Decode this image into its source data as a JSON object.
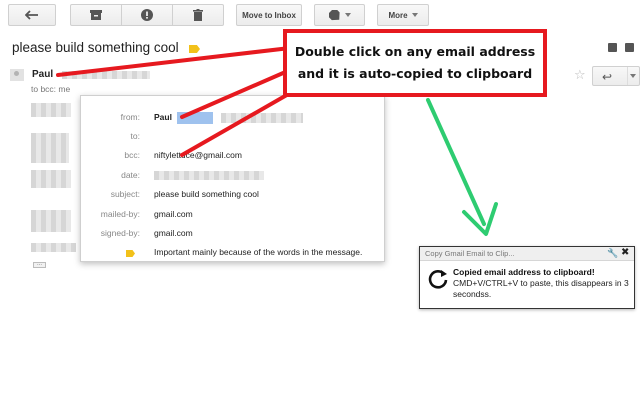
{
  "toolbar": {
    "move_to_inbox_label": "Move to Inbox",
    "more_label": "More",
    "icons": [
      "back-arrow-icon",
      "archive-icon",
      "report-spam-icon",
      "trash-icon",
      "label-icon"
    ]
  },
  "email": {
    "subject": "please build something cool",
    "sender_name": "Paul",
    "to_line": "to bcc: me"
  },
  "details": {
    "rows": [
      {
        "key": "from:",
        "value": "Paul"
      },
      {
        "key": "to:",
        "value": ""
      },
      {
        "key": "bcc:",
        "value": "niftylettuce@gmail.com"
      },
      {
        "key": "date:",
        "value": ""
      },
      {
        "key": "subject:",
        "value": "please build something cool"
      },
      {
        "key": "mailed-by:",
        "value": "gmail.com"
      },
      {
        "key": "signed-by:",
        "value": "gmail.com"
      },
      {
        "key": "",
        "value": "Important mainly because of the words in the message."
      }
    ]
  },
  "callout": {
    "line1": "Double click on any email address",
    "line2": "and it is auto-copied to clipboard"
  },
  "notification": {
    "title": "Copy Gmail Email to Clip...",
    "heading": "Copied email address to clipboard!",
    "body": "CMD+V/CTRL+V to paste, this disappears in 3 secondss."
  },
  "colors": {
    "callout_border": "#e6191f",
    "arrow_red": "#e6191f",
    "arrow_green": "#2ecc71",
    "label_yellow": "#f2c11a",
    "selection_blue": "#9fc2ee"
  }
}
